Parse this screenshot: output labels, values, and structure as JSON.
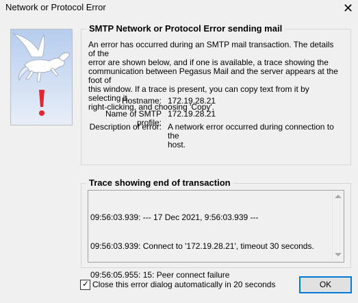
{
  "window": {
    "title": "Network or Protocol Error",
    "close_symbol": "✕"
  },
  "error_group": {
    "title": "SMTP Network or Protocol Error sending mail",
    "description_lines": [
      "An error has occurred during an SMTP mail transaction. The details of the",
      "error are shown below, and if one is available, a trace showing the",
      "communication between Pegasus Mail and the server appears at the foot of",
      "this window. If a trace is present, you can copy text from it by selecting it,",
      "right-clicking, and choosing 'Copy'."
    ],
    "fields": {
      "hostname_label": "Hostname:",
      "hostname_value": "172.19.28.21",
      "profile_label": "Name of SMTP profile:",
      "profile_value": "172.19.28.21",
      "error_label": "Description of error:",
      "error_value_lines": [
        "A network error occurred during connection to the",
        "host."
      ]
    }
  },
  "trace_group": {
    "title": "Trace showing end of transaction",
    "lines": [
      "09:56:03.939: --- 17 Dec 2021, 9:56:03.939 ---",
      "09:56:03.939: Connect to '172.19.28.21', timeout 30 seconds.",
      "09:56:05.955: 15: Peer connect failure"
    ]
  },
  "footer": {
    "auto_close_label": "Close this error dialog automatically in 20 seconds",
    "auto_close_checked": true,
    "ok_label": "OK"
  },
  "colors": {
    "background": "#f0f0f0",
    "focus_border": "#0078d7",
    "exclamation": "#e3262e"
  },
  "icons": [
    "pegasus-logo",
    "exclamation-icon",
    "close-icon",
    "scroll-up-icon",
    "scroll-down-icon",
    "checkmark-icon"
  ]
}
